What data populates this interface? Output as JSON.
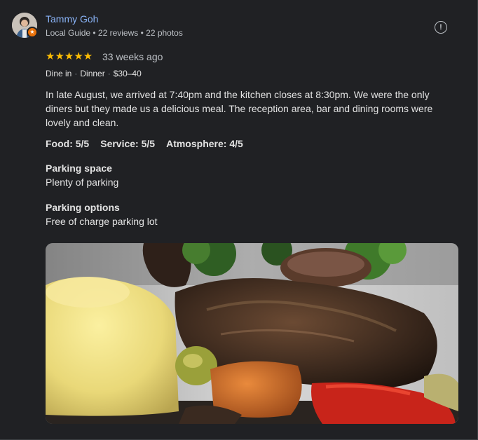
{
  "reviewer": {
    "name": "Tammy Goh",
    "meta": "Local Guide • 22 reviews • 22 photos",
    "avatar_icon": "avatar-icon",
    "badge_icon": "local-guide-star-icon"
  },
  "review": {
    "rating": 5,
    "stars": "★★★★★",
    "time_ago": "33 weeks ago",
    "tags": [
      "Dine in",
      "Dinner",
      "$30–40"
    ],
    "text": "In late August, we arrived at 7:40pm and the kitchen closes at 8:30pm. We were the only diners but they made us a delicious meal. The reception area, bar and dining rooms were lovely and clean.",
    "ratings": {
      "food": "Food: 5/5",
      "service": "Service: 5/5",
      "atmosphere": "Atmosphere: 4/5"
    },
    "parking_space": {
      "heading": "Parking space",
      "value": "Plenty of parking"
    },
    "parking_options": {
      "heading": "Parking options",
      "value": "Free of charge parking lot"
    }
  },
  "actions": {
    "report_icon": "report-icon"
  },
  "colors": {
    "background": "#202124",
    "name_link": "#8ab4f8",
    "star": "#fbbc04",
    "badge": "#e8710a"
  }
}
